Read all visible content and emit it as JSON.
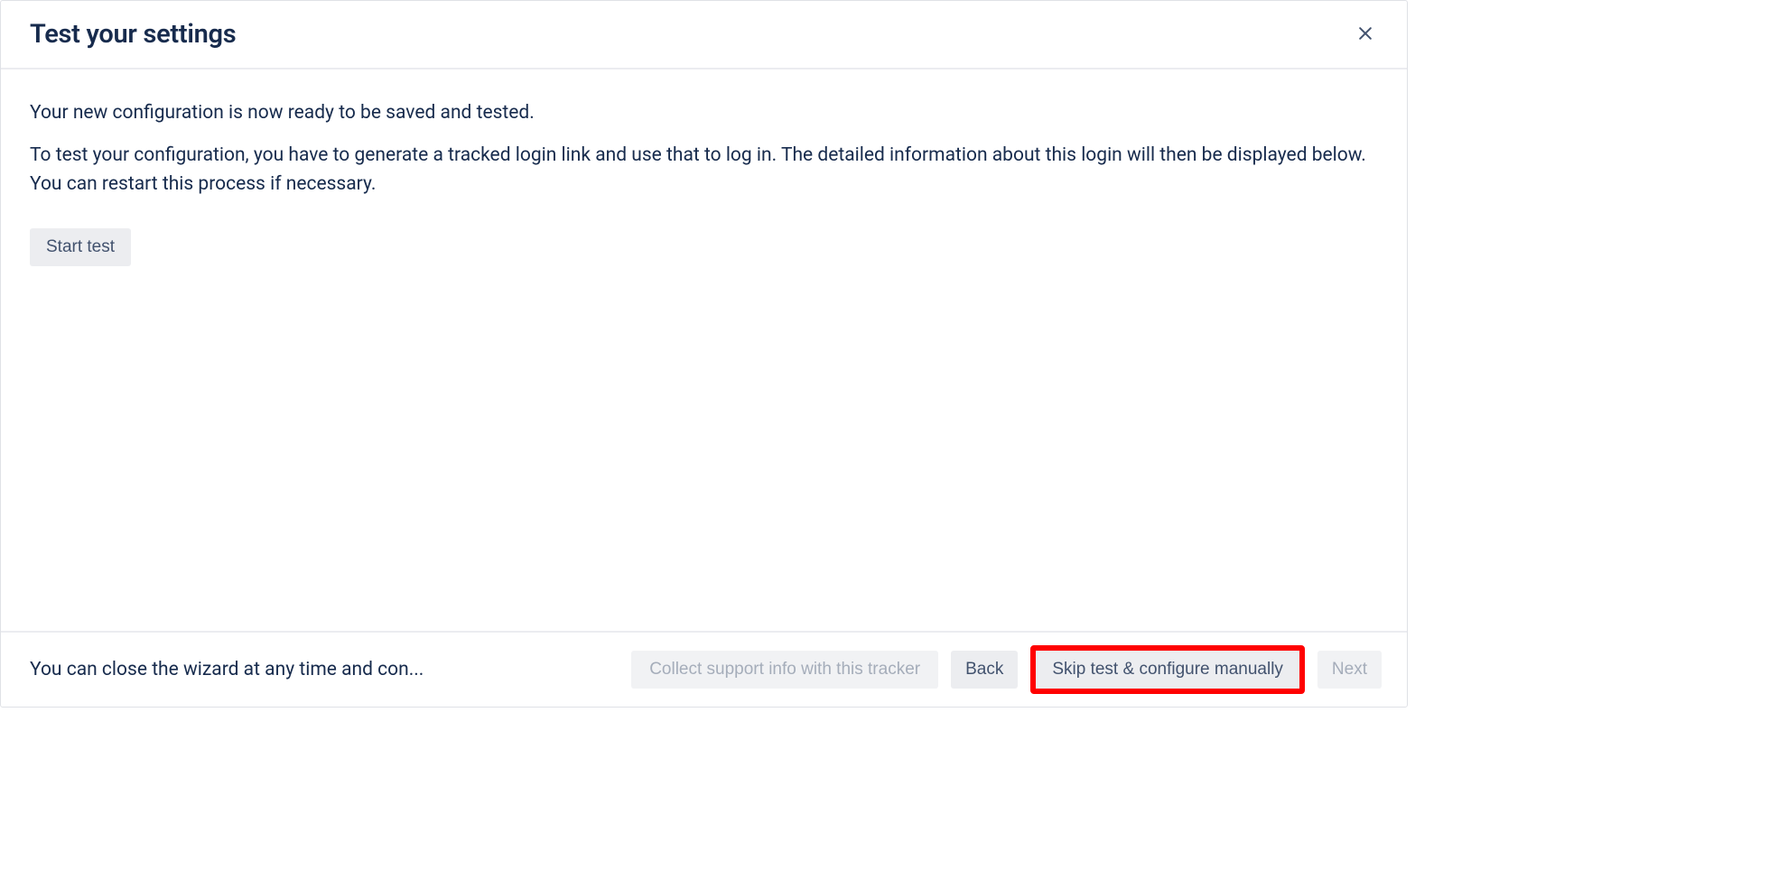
{
  "dialog": {
    "title": "Test your settings",
    "intro1": "Your new configuration is now ready to be saved and tested.",
    "intro2": "To test your configuration, you have to generate a tracked login link and use that to log in. The detailed information about this login will then be displayed below. You can restart this process if necessary.",
    "start_test_label": "Start test"
  },
  "footer": {
    "hint": "You can close the wizard at any time and con...",
    "collect_label": "Collect support info with this tracker",
    "back_label": "Back",
    "skip_label": "Skip test & configure manually",
    "next_label": "Next"
  }
}
